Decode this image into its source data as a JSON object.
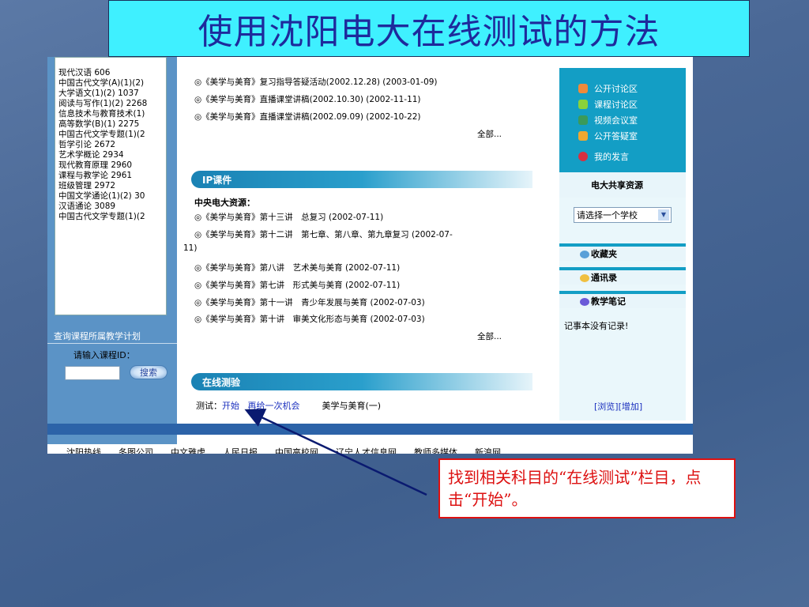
{
  "slide_title": "使用沈阳电大在线测试的方法",
  "course_list": [
    "现代汉语 606",
    "中国古代文学(A)(1)(2)",
    "大学语文(1)(2) 1037",
    "阅读与写作(1)(2) 2268",
    "信息技术与教育技术(1)",
    "高等数学(B)(1) 2275",
    "中国古代文学专题(1)(2",
    "哲学引论 2672",
    "艺术学概论 2934",
    "现代教育原理 2960",
    "课程与教学论 2961",
    "班级管理 2972",
    "中国文学通论(1)(2) 30",
    "汉语通论 3089",
    "中国古代文学专题(1)(2"
  ],
  "query": {
    "label": "查询课程所属教学计划",
    "input_label": "请输入课程ID：",
    "search_label": "搜索"
  },
  "top_items": [
    "◎《美学与美育》复习指导答疑活动(2002.12.28) (2003-01-09)",
    "◎《美学与美育》直播课堂讲稿(2002.10.30) (2002-11-11)",
    "◎《美学与美育》直播课堂讲稿(2002.09.09) (2002-10-22)"
  ],
  "more_label": "全部...",
  "ip_section": {
    "title": "IP课件",
    "subhead": "中央电大资源：",
    "items": [
      "◎《美学与美育》第十三讲　总复习 (2002-07-11)",
      "◎《美学与美育》第十二讲　第七章、第八章、第九章复习 (2002-07-",
      "11)",
      "◎《美学与美育》第八讲　艺术美与美育 (2002-07-11)",
      "◎《美学与美育》第七讲　形式美与美育 (2002-07-11)",
      "◎《美学与美育》第十一讲　青少年发展与美育 (2002-07-03)",
      "◎《美学与美育》第十讲　审美文化形态与美育 (2002-07-03)"
    ]
  },
  "online_test": {
    "title": "在线测验",
    "prefix": "测试：",
    "start_label": "开始",
    "retry_label": "再给一次机会",
    "course": "美学与美育(一)"
  },
  "right_panel": {
    "forum_items": [
      "公开讨论区",
      "课程讨论区",
      "视频会议室",
      "公开答疑室",
      "我的发言"
    ],
    "share_title": "电大共享资源",
    "school_select": "请选择一个学校",
    "bars": [
      "收藏夹",
      "通讯录",
      "教学笔记"
    ],
    "notes_empty": "记事本没有记录!",
    "browse_add": "[浏览][增加]"
  },
  "bottom_links": "沈阳热线　　冬图公司　　中文雅虎　　人民日报　　中国高校网　　辽宁人才信息网　　教师多媒体　　新浪网",
  "callout": "找到相关科目的“在线测试”栏目，点击“开始”。"
}
